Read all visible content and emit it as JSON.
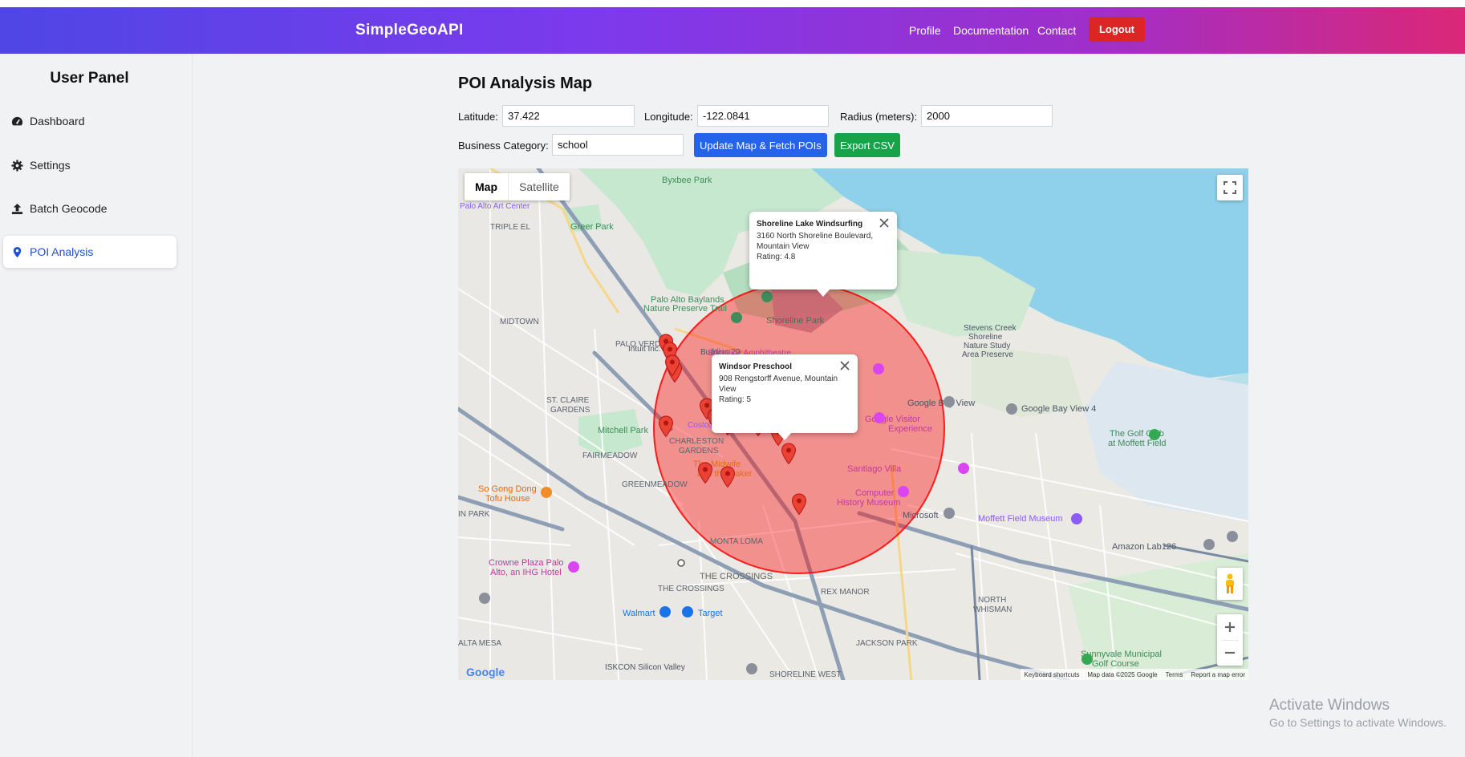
{
  "header": {
    "brand": "SimpleGeoAPI",
    "nav": [
      "Profile",
      "Documentation",
      "Contact"
    ],
    "logout_label": "Logout",
    "gradient": [
      "#4f46e5",
      "#7c3aed",
      "#db2777"
    ]
  },
  "sidebar": {
    "title": "User Panel",
    "items": [
      {
        "label": "Dashboard",
        "icon": "dashboard-icon"
      },
      {
        "label": "Settings",
        "icon": "gear-icon"
      },
      {
        "label": "Batch Geocode",
        "icon": "upload-icon"
      },
      {
        "label": "POI Analysis",
        "icon": "map-pin-icon",
        "active": true
      }
    ]
  },
  "main": {
    "title": "POI Analysis Map",
    "lat_label": "Latitude:",
    "lat_value": "37.422",
    "lon_label": "Longitude:",
    "lon_value": "-122.0841",
    "radius_label": "Radius (meters):",
    "radius_value": "2000",
    "category_label": "Business Category:",
    "category_value": "school",
    "update_button": "Update Map & Fetch POIs",
    "export_button": "Export CSV",
    "accent_blue": "#2563eb",
    "accent_green": "#16a34a"
  },
  "map": {
    "type_map": "Map",
    "type_satellite": "Satellite",
    "circle_color": "#ff0000",
    "labels": {
      "baylands": "Palo Alto Baylands",
      "baylands2": "Nature Preserve Trail",
      "shoreline_park": "Shoreline Park",
      "amphitheatre": "Shoreline Amphitheatre",
      "byxbee": "Byxbee Park",
      "greer": "Greer Park",
      "triple_el": "TRIPLE EL",
      "midtown": "MIDTOWN",
      "palo_verde": "PALO VERDE",
      "st_claire": "ST. CLAIRE",
      "gardens": "GARDENS",
      "mitchell": "Mitchell Park",
      "charleston": "CHARLESTON",
      "charleston2": "GARDENS",
      "fairmeadow": "FAIRMEADOW",
      "greenmeadow": "GREENMEADOW",
      "monta": "MONTA LOMA",
      "crossings": "THE CROSSINGS",
      "rex": "REX MANOR",
      "north_whisman": "NORTH",
      "north_whisman2": "WHISMAN",
      "jackson": "JACKSON PARK",
      "shoreline_west": "SHORELINE WEST",
      "alta_mesa": "ALTA MESA",
      "google_bay": "Google Bay View",
      "google_bay4": "Google Bay View 4",
      "golf": "The Golf Club",
      "golf2": "at Moffett Field",
      "moffett": "Moffett Field Museum",
      "amazon": "Amazon Lab126",
      "sunnyvale_golf": "Sunnyvale Municipal",
      "sunnyvale_golf2": "Golf Course",
      "so_gong": "So Gong Dong",
      "so_gong2": "Tofu House",
      "crowne": "Crowne Plaza Palo",
      "crowne2": "Alto, an IHG Hotel",
      "walmart": "Walmart",
      "target": "Target",
      "iskcon": "ISKCON Silicon Valley",
      "google_visitor": "Google Visitor",
      "google_visitor2": "Experience",
      "santiago": "Santiago Villa",
      "computer": "Computer",
      "computer2": "History Museum",
      "microsoft": "Microsoft",
      "intuit": "Intuit Inc.",
      "building20": "Building 20",
      "costco": "Costco",
      "midwife": "The Midwife",
      "midwife2": "and the Baker",
      "stevens": "Stevens Creek",
      "stevens2": "Shoreline",
      "stevens3": "Nature Study",
      "stevens4": "Area Preserve",
      "art_center": "Palo Alto Art Center",
      "park": "IN PARK"
    },
    "popup1": {
      "title": "Shoreline Lake Windsurfing",
      "line1": "3160 North Shoreline Boulevard,",
      "line2": "Mountain View",
      "rating": "Rating: 4.8"
    },
    "popup2": {
      "title": "Windsor Preschool",
      "line1": "908 Rengstorff Avenue, Mountain",
      "line2": "View",
      "rating": "Rating: 5"
    },
    "attribution": {
      "shortcuts": "Keyboard shortcuts",
      "data": "Map data ©2025 Google",
      "terms": "Terms",
      "report": "Report a map error"
    },
    "logo": "Google"
  },
  "watermark": {
    "line1": "Activate Windows",
    "line2": "Go to Settings to activate Windows."
  }
}
